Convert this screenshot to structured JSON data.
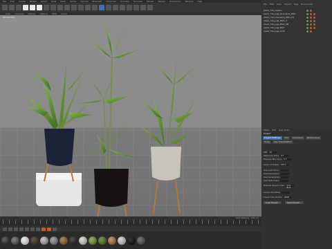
{
  "menubar": {
    "items": [
      "File",
      "Edit",
      "Create",
      "Modes",
      "Select",
      "Tools",
      "Mesh",
      "Spline",
      "Volume",
      "MoGraph",
      "Character",
      "Animate",
      "Simulate",
      "Tracker",
      "Render",
      "Extensions",
      "Window",
      "Help"
    ]
  },
  "viewport": {
    "menu": [
      "View",
      "Cameras",
      "Display",
      "Options",
      "Filter",
      "Panel"
    ],
    "label": "Perspective"
  },
  "status": {
    "text": "Grid Spacing : 100 cm"
  },
  "object_manager": {
    "menu": [
      "File",
      "Edit",
      "View",
      "Object",
      "Tags",
      "Bookmarks"
    ],
    "rows": [
      "plant_Y16_square",
      "plant_Y16_Jugs_Dracaena_NSH",
      "plant_Y16_Dracaena_NSH_01",
      "plant_Y16_Jugs_NSH_3",
      "plant_Y16_Jugs_NSH_2B",
      "plant_Y16_Jugs_NSH",
      "plant_Y16_Jugs_both"
    ]
  },
  "attributes": {
    "menu": [
      "Mode",
      "Edit",
      "User Data"
    ],
    "title": "Project",
    "tabs": [
      "Project Settings",
      "Info",
      "Dynamics",
      "Referencing",
      "To Do",
      "Key Interpolation"
    ],
    "rows": [
      {
        "label": "FPS",
        "value": "30"
      },
      {
        "label": "Minimum Time",
        "value": "0 F"
      },
      {
        "label": "Preview Min Time",
        "value": "0 F"
      },
      {
        "label": "Level of Detail",
        "value": "100 %"
      },
      {
        "label": "Use Animation",
        "value": ""
      },
      {
        "label": "Use Expression",
        "value": ""
      },
      {
        "label": "Use Generators",
        "value": ""
      },
      {
        "label": "Use Deformers",
        "value": ""
      },
      {
        "label": "Default Object Color",
        "value": "Gray Blue"
      },
      {
        "label": "Linear Workflow",
        "value": ""
      },
      {
        "label": "Input Color Profile",
        "value": "sRGB"
      }
    ],
    "buttons": [
      "Load Preset...",
      "Save Preset..."
    ]
  }
}
